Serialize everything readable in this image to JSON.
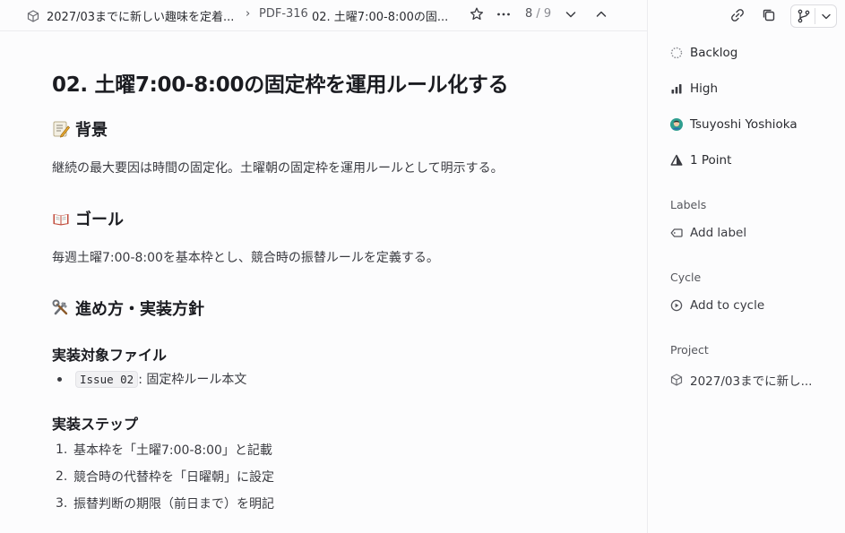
{
  "header": {
    "project_crumb": "2027/03までに新しい趣味を定着...",
    "separator": "›",
    "issue_id": "PDF-316",
    "issue_title_crumb": "02. 土曜7:00-8:00の固...",
    "pager_current": "8",
    "pager_total": "/ 9"
  },
  "document": {
    "title": "02. 土曜7:00-8:00の固定枠を運用ルール化する",
    "sections": [
      {
        "heading": "背景",
        "body": "継続の最大要因は時間の固定化。土曜朝の固定枠を運用ルールとして明示する。"
      },
      {
        "heading": "ゴール",
        "body": "毎週土曜7:00-8:00を基本枠とし、競合時の振替ルールを定義する。"
      },
      {
        "heading": "進め方・実装方針"
      }
    ],
    "target_files_heading": "実装対象ファイル",
    "target_files": [
      {
        "code": "Issue 02",
        "text": ": 固定枠ルール本文"
      }
    ],
    "steps_heading": "実装ステップ",
    "steps": [
      {
        "num": "1.",
        "text": "基本枠を「土曜7:00-8:00」と記載"
      },
      {
        "num": "2.",
        "text": "競合時の代替枠を「日曜朝」に設定"
      },
      {
        "num": "3.",
        "text": "振替判断の期限（前日まで）を明記"
      }
    ]
  },
  "panel": {
    "status": "Backlog",
    "priority": "High",
    "assignee": "Tsuyoshi Yoshioka",
    "estimate": "1 Point",
    "labels_label": "Labels",
    "add_label": "Add label",
    "cycle_label": "Cycle",
    "add_cycle": "Add to cycle",
    "project_label": "Project",
    "project_value": "2027/03までに新し..."
  },
  "colors": {
    "accent_avatar": "#2f9e8f",
    "text_primary": "#1b1c21",
    "text_muted": "#55565c",
    "border": "#ececef"
  }
}
